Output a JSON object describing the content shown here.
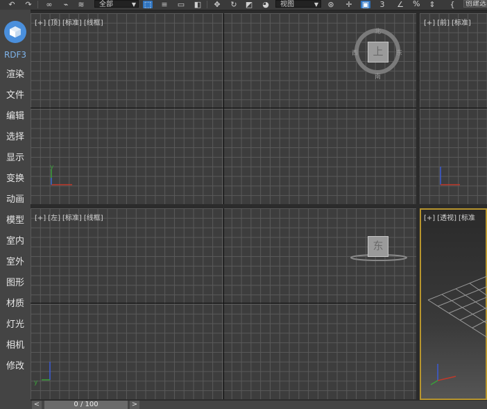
{
  "toolbar": {
    "filter_select": "全部",
    "view_select": "视图",
    "percent_label": "%",
    "create_button": "创建选"
  },
  "sidebar": {
    "brand": "RDF3",
    "items": [
      {
        "label": "渲染"
      },
      {
        "label": "文件"
      },
      {
        "label": "编辑"
      },
      {
        "label": "选择"
      },
      {
        "label": "显示"
      },
      {
        "label": "变换"
      },
      {
        "label": "动画"
      },
      {
        "label": "模型"
      },
      {
        "label": "室内"
      },
      {
        "label": "室外"
      },
      {
        "label": "图形"
      },
      {
        "label": "材质"
      },
      {
        "label": "灯光"
      },
      {
        "label": "相机"
      },
      {
        "label": "修改"
      }
    ]
  },
  "viewports": {
    "top": {
      "plus": "[+]",
      "view": "[顶]",
      "shading": "[标准]",
      "mode": "[线框]"
    },
    "front": {
      "plus": "[+]",
      "view": "[前]",
      "shading": "[标准]"
    },
    "left": {
      "plus": "[+]",
      "view": "[左]",
      "shading": "[标准]",
      "mode": "[线框]"
    },
    "perspective": {
      "plus": "[+]",
      "view": "[透视]",
      "shading": "[标准"
    }
  },
  "viewcube": {
    "top_face": "上",
    "north": "北",
    "south": "南",
    "east": "东",
    "west": "西",
    "left_face": "东"
  },
  "axes": {
    "x": "x",
    "y": "y",
    "z": "z"
  },
  "timeline": {
    "prev": "<",
    "next": ">",
    "frame": "0 / 100"
  }
}
